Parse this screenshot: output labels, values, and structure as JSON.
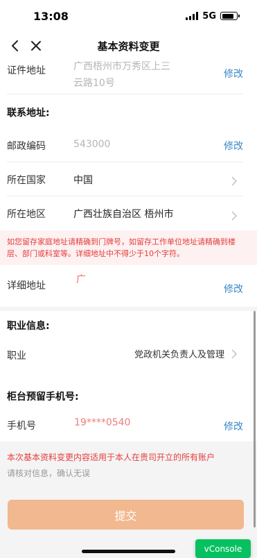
{
  "status_bar": {
    "time": "13:08",
    "network": "5G"
  },
  "nav": {
    "title": "基本资料变更"
  },
  "id_address": {
    "label": "证件地址",
    "value_line1": "广西梧州市万秀区上三",
    "value_line2": "云路10号",
    "action": "修改"
  },
  "contact_section": {
    "title": "联系地址:"
  },
  "postal": {
    "label": "邮政编码",
    "value": "543000",
    "action": "修改"
  },
  "country": {
    "label": "所在国家",
    "value": "中国"
  },
  "region": {
    "label": "所在地区",
    "value": "广西壮族自治区 梧州市"
  },
  "address_notice": {
    "text": "如您留存家庭地址请精确到门牌号，如留存工作单位地址请精确到楼层、部门或科室等。详细地址中不得少于10个字符。"
  },
  "detail_address": {
    "label": "详细地址",
    "value": "广",
    "action": "修改"
  },
  "job_section": {
    "title": "职业信息:"
  },
  "job": {
    "label": "职业",
    "value": "党政机关负责人及管理"
  },
  "phone_section": {
    "title": "柜台预留手机号:"
  },
  "phone": {
    "label": "手机号",
    "value": "19****0540",
    "action": "修改"
  },
  "footer": {
    "note1": "本次基本资料变更内容适用于本人在贵司开立的所有账户",
    "note2": "请核对信息，确认无误",
    "submit_label": "提交"
  },
  "vconsole_label": "vConsole",
  "colors": {
    "accent": "#3a86c8",
    "warning": "#e53d3d",
    "submit_bg": "#f2b88f",
    "vconsole_bg": "#07c160"
  },
  "icons": {
    "back": "chevron-left-icon",
    "close": "close-icon",
    "row_arrow": "chevron-right-icon"
  }
}
